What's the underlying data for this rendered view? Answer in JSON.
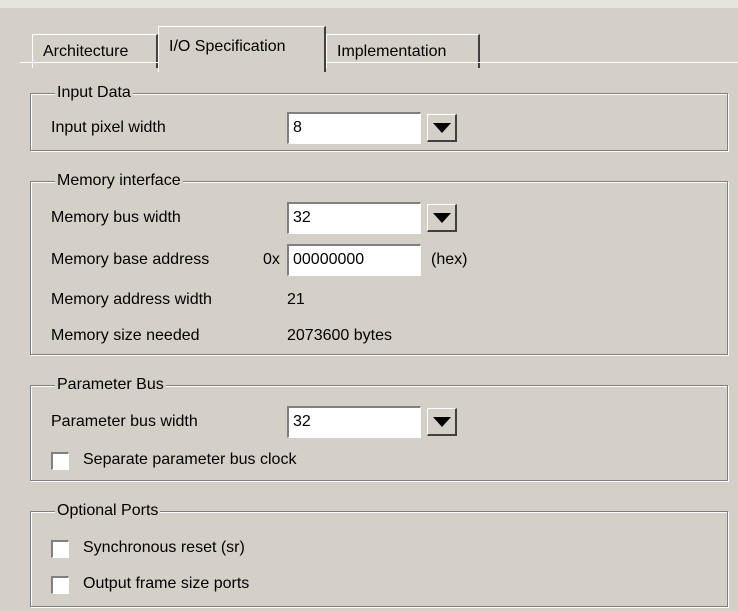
{
  "tabs": [
    {
      "label": "Architecture"
    },
    {
      "label": "I/O Specification"
    },
    {
      "label": "Implementation"
    }
  ],
  "input_data": {
    "legend": "Input Data",
    "pixel_width_label": "Input pixel width",
    "pixel_width_value": "8"
  },
  "memory": {
    "legend": "Memory interface",
    "bus_width_label": "Memory bus width",
    "bus_width_value": "32",
    "base_address_label": "Memory base address",
    "base_address_prefix": "0x",
    "base_address_value": "00000000",
    "base_address_unit": "(hex)",
    "address_width_label": "Memory address width",
    "address_width_value": "21",
    "size_label": "Memory size needed",
    "size_value": "2073600 bytes"
  },
  "parameter_bus": {
    "legend": "Parameter Bus",
    "width_label": "Parameter bus width",
    "width_value": "32",
    "separate_clock_label": "Separate parameter bus clock"
  },
  "optional_ports": {
    "legend": "Optional Ports",
    "sync_reset_label": "Synchronous reset (sr)",
    "frame_size_label": "Output frame size ports"
  },
  "colors": {
    "dialog_bg": "#d4d0c8",
    "field_bg": "#ffffff"
  }
}
